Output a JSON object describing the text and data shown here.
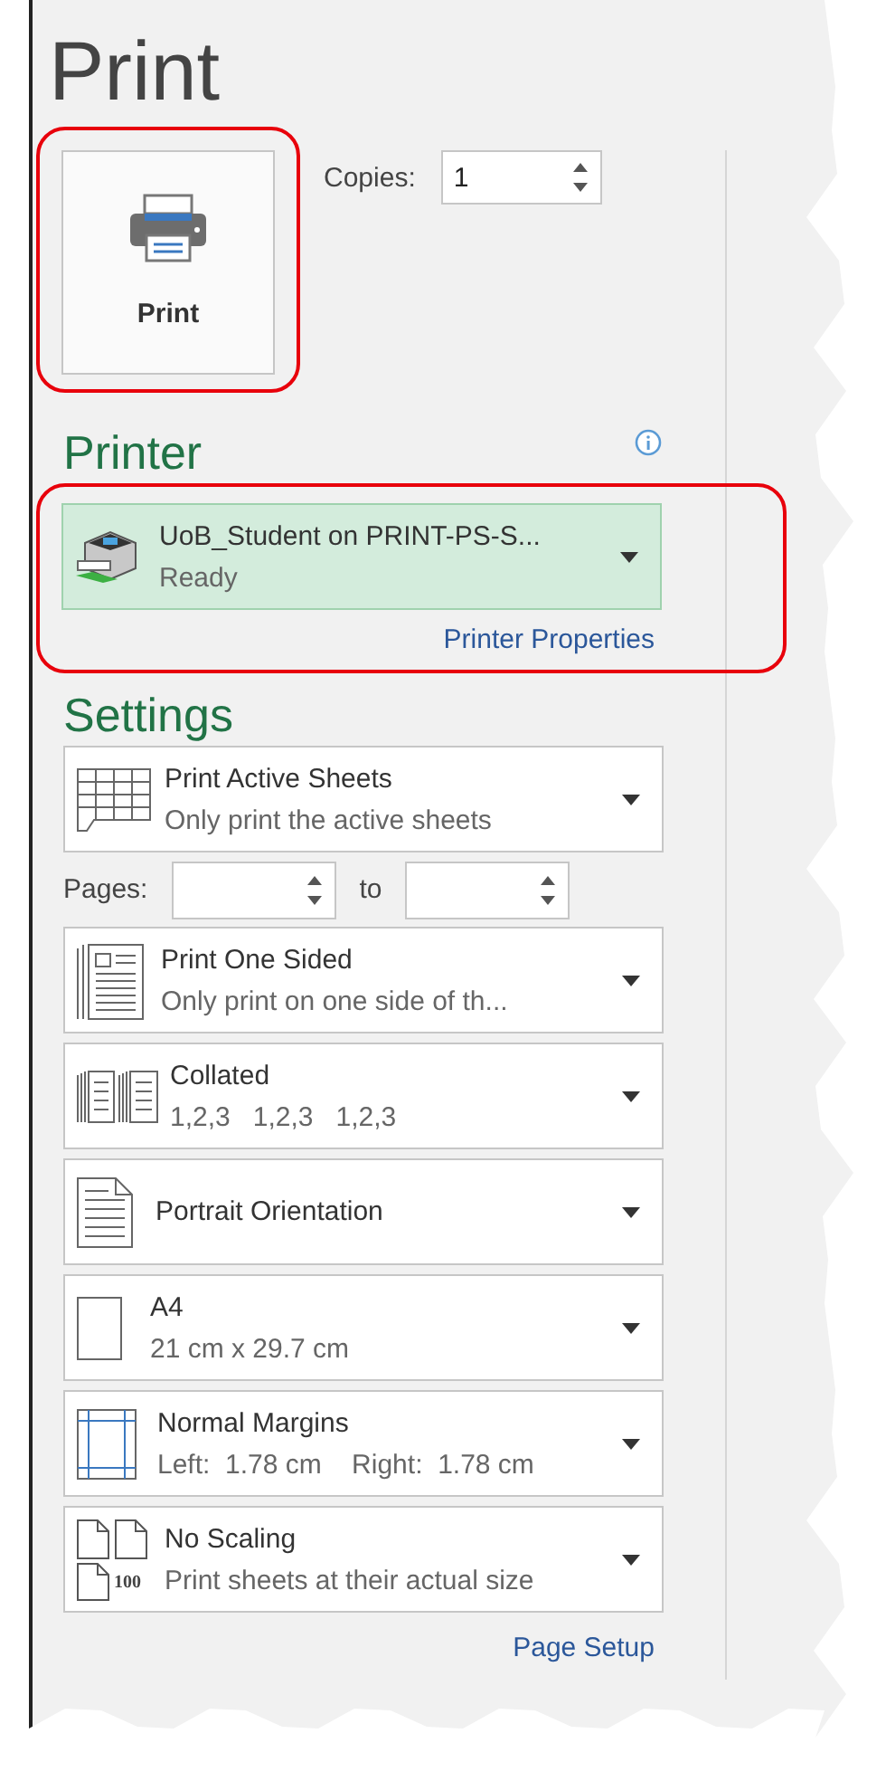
{
  "title": "Print",
  "print_button": {
    "label": "Print",
    "highlighted": true
  },
  "copies": {
    "label": "Copies:",
    "value": "1"
  },
  "printer": {
    "heading": "Printer",
    "highlighted": true,
    "name": "UoB_Student on PRINT-PS-S...",
    "status": "Ready",
    "properties_link": "Printer Properties"
  },
  "settings": {
    "heading": "Settings",
    "items": [
      {
        "kind": "sheets",
        "title": "Print Active Sheets",
        "subtitle": "Only print the active sheets"
      },
      {
        "kind": "pages",
        "label": "Pages:",
        "to_label": "to"
      },
      {
        "kind": "sides",
        "title": "Print One Sided",
        "subtitle": "Only print on one side of th..."
      },
      {
        "kind": "collate",
        "title": "Collated",
        "subtitle": "1,2,3   1,2,3   1,2,3"
      },
      {
        "kind": "orientation",
        "title": "Portrait Orientation"
      },
      {
        "kind": "paper",
        "title": "A4",
        "subtitle": "21 cm x 29.7 cm"
      },
      {
        "kind": "margins",
        "title": "Normal Margins",
        "subtitle": "Left:  1.78 cm    Right:  1.78 cm"
      },
      {
        "kind": "scaling",
        "title": "No Scaling",
        "subtitle": "Print sheets at their actual size",
        "icon_text": "100"
      }
    ],
    "page_setup_link": "Page Setup"
  }
}
